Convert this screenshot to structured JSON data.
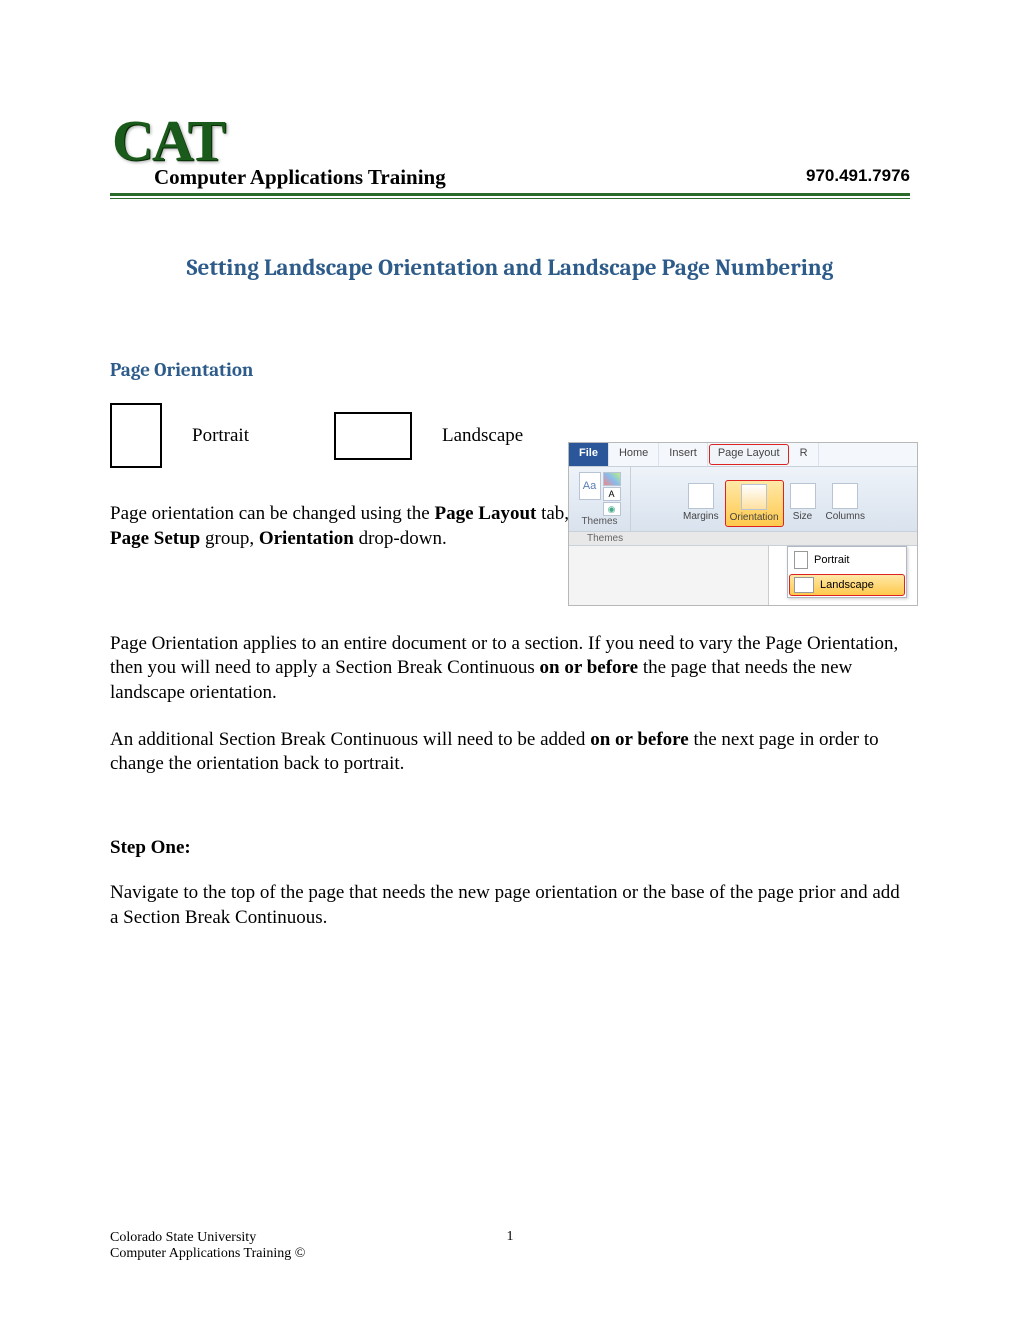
{
  "header": {
    "logo_text": "CAT",
    "logo_subtitle": "Computer Applications Training",
    "phone": "970.491.7976"
  },
  "title": "Setting Landscape Orientation and  Landscape Page Numbering",
  "section1": {
    "heading": "Page Orientation",
    "portrait_label": "Portrait",
    "landscape_label": "Landscape"
  },
  "para1": {
    "pre": "Page orientation can be changed using the ",
    "b1": "Page Layout",
    "mid1": " tab, ",
    "b2": "Page Setup",
    "mid2": " group, ",
    "b3": "Orientation",
    "post": " drop-down."
  },
  "para2": {
    "pre": "Page Orientation applies to an entire document or to a section.  If you need to vary the Page Orientation, then you will need to apply a Section Break Continuous ",
    "b1": "on or before",
    "post": " the page that needs the new landscape orientation."
  },
  "para3": {
    "pre": "An additional Section Break Continuous will need to be added ",
    "b1": "on or before",
    "post": " the next page in order to change the orientation back to portrait."
  },
  "step1": {
    "heading": "Step One:",
    "text": "Navigate to the top of the page that needs the new page orientation or the base of the page prior and add a Section Break Continuous."
  },
  "ribbon": {
    "tabs": {
      "file": "File",
      "home": "Home",
      "insert": "Insert",
      "page_layout": "Page Layout",
      "r": "R"
    },
    "themes_label": "Themes",
    "themes_aa": "Aa",
    "themes_a": "A",
    "margins": "Margins",
    "orientation": "Orientation",
    "size": "Size",
    "columns": "Columns",
    "dropdown": {
      "portrait": "Portrait",
      "landscape": "Landscape"
    }
  },
  "footer": {
    "page_number": "1",
    "line1": "Colorado State University",
    "line2": "Computer Applications Training ©"
  }
}
